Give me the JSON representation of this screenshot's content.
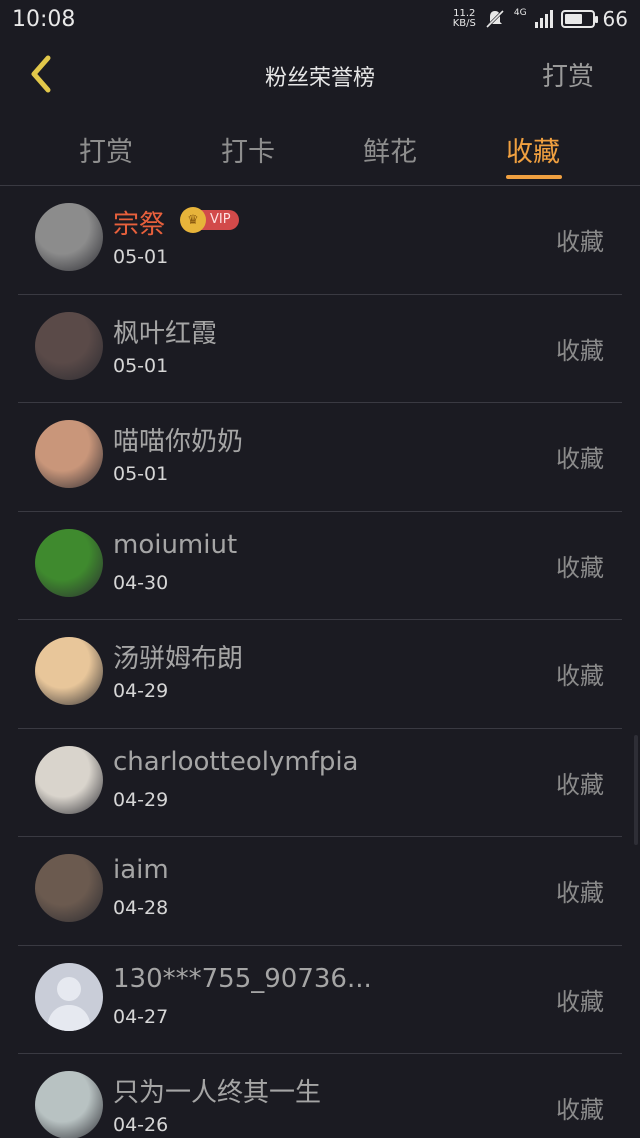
{
  "status_bar": {
    "time": "10:08",
    "net_speed_value": "11.2",
    "net_speed_unit": "KB/S",
    "network_type": "4G",
    "battery": "66"
  },
  "header": {
    "title": "粉丝荣誉榜",
    "action_label": "打赏"
  },
  "tabs": [
    {
      "label": "打赏",
      "active": false
    },
    {
      "label": "打卡",
      "active": false
    },
    {
      "label": "鲜花",
      "active": false
    },
    {
      "label": "收藏",
      "active": true
    }
  ],
  "vip_label": "VIP",
  "list": [
    {
      "name": "宗祭",
      "date": "05-01",
      "action": "收藏",
      "vip": true,
      "avatar_color": "#8c8c8c"
    },
    {
      "name": "枫叶红霞",
      "date": "05-01",
      "action": "收藏",
      "vip": false,
      "avatar_color": "#5a4a48"
    },
    {
      "name": "喵喵你奶奶",
      "date": "05-01",
      "action": "收藏",
      "vip": false,
      "avatar_color": "#c9967a"
    },
    {
      "name": "moiumiut",
      "date": "04-30",
      "action": "收藏",
      "vip": false,
      "avatar_color": "#3f8a2e"
    },
    {
      "name": "汤骈姆布朗",
      "date": "04-29",
      "action": "收藏",
      "vip": false,
      "avatar_color": "#e8c69a"
    },
    {
      "name": "charlootteolymfpia",
      "date": "04-29",
      "action": "收藏",
      "vip": false,
      "avatar_color": "#d9d4cc"
    },
    {
      "name": "iaim",
      "date": "04-28",
      "action": "收藏",
      "vip": false,
      "avatar_color": "#6b5a4f"
    },
    {
      "name": "130***755_90736...",
      "date": "04-27",
      "action": "收藏",
      "vip": false,
      "avatar_color": "#c9cdd8"
    },
    {
      "name": "只为一人终其一生",
      "date": "04-26",
      "action": "收藏",
      "vip": false,
      "avatar_color": "#b8c2c2"
    }
  ],
  "colors": {
    "background": "#1b1b22",
    "accent": "#f0a040",
    "vip_name": "#e8603c",
    "divider": "#3a3a42"
  }
}
